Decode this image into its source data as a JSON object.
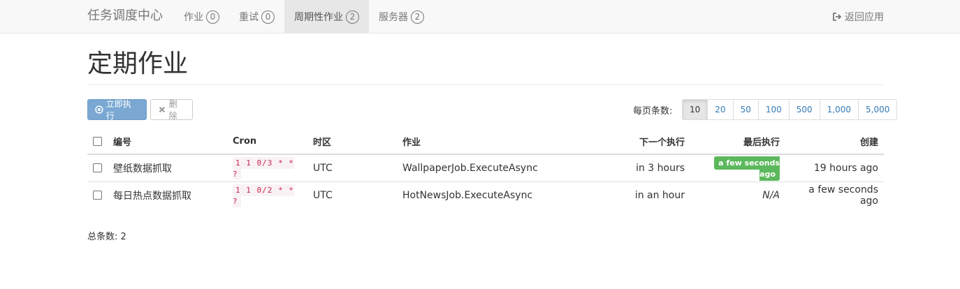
{
  "nav": {
    "brand": "任务调度中心",
    "items": [
      {
        "label": "作业",
        "count": "0"
      },
      {
        "label": "重试",
        "count": "0"
      },
      {
        "label": "周期性作业",
        "count": "2"
      },
      {
        "label": "服务器",
        "count": "2"
      }
    ],
    "active_item": "周期性作业",
    "back_label": "返回应用"
  },
  "page": {
    "title": "定期作业"
  },
  "toolbar": {
    "trigger_label": "立即执行",
    "delete_label": "删除"
  },
  "pagination": {
    "per_page_label": "每页条数:",
    "options": [
      "10",
      "20",
      "50",
      "100",
      "500",
      "1,000",
      "5,000"
    ],
    "selected": "10"
  },
  "table": {
    "headers": {
      "id": "编号",
      "cron": "Cron",
      "timezone": "时区",
      "job": "作业",
      "next": "下一个执行",
      "last": "最后执行",
      "created": "创建"
    },
    "rows": [
      {
        "id": "壁纸数据抓取",
        "cron": "1 1 0/3 * * ?",
        "timezone": "UTC",
        "job": "WallpaperJob.ExecuteAsync",
        "next": "in 3 hours",
        "last": "a few seconds ago",
        "created": "19 hours ago"
      },
      {
        "id": "每日热点数据抓取",
        "cron": "1 1 0/2 * * ?",
        "timezone": "UTC",
        "job": "HotNewsJob.ExecuteAsync",
        "next": "in an hour",
        "last": "N/A",
        "created": "a few seconds ago"
      }
    ]
  },
  "footer": {
    "total_label": "总条数: 2"
  },
  "colors": {
    "success": "#5cb85c",
    "primary": "#7aa8d3",
    "link": "#337ab7"
  },
  "icons": {
    "back": "sign-out-icon",
    "trigger": "play-circle-icon",
    "delete": "times-icon"
  }
}
